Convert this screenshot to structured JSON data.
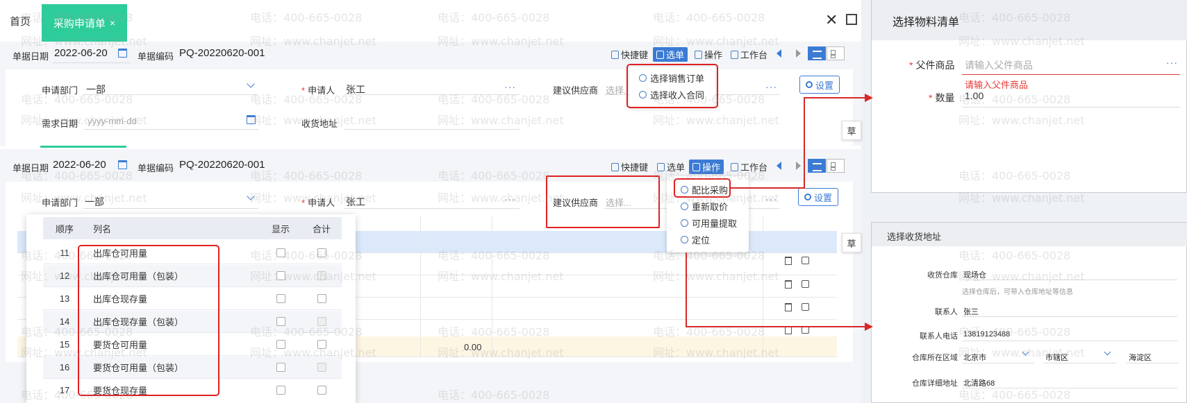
{
  "tabs": {
    "home": "首页",
    "active": "采购申请单",
    "close": "×"
  },
  "window": {
    "close": "✕"
  },
  "form": {
    "date_label": "单据日期",
    "date_value": "2022-06-20",
    "code_label": "单据编码",
    "code_value": "PQ-20220620-001",
    "dept_label": "申请部门",
    "dept_value": "一部",
    "applicant_label": "申请人",
    "applicant_value": "张工",
    "supplier_label": "建议供应商",
    "supplier_placeholder_short": "选择.",
    "supplier_placeholder": "选择...",
    "need_date_label": "需求日期",
    "need_date_placeholder": "yyyy-mm-dd",
    "address_label": "收货地址",
    "settings": "设置",
    "more": "···",
    "required": "*"
  },
  "toolbar": {
    "shortcut": "快捷键",
    "select_doc": "选单",
    "operation": "操作",
    "workbench": "工作台"
  },
  "select_menu": [
    "选择销售订单",
    "选择收入合同"
  ],
  "operation_menu": [
    "配比采购",
    "重新取价",
    "可用量提取",
    "定位"
  ],
  "drawer": {
    "draft": "草"
  },
  "grid": {
    "sum_value": "0.00"
  },
  "column_panel": {
    "headers": {
      "no": "顺序",
      "name": "列名",
      "show": "显示",
      "sum": "合计"
    },
    "rows": [
      {
        "no": "11",
        "name": "出库仓可用量",
        "sum_disabled": false
      },
      {
        "no": "12",
        "name": "出库仓可用量（包装）",
        "sum_disabled": true
      },
      {
        "no": "13",
        "name": "出库仓现存量",
        "sum_disabled": false
      },
      {
        "no": "14",
        "name": "出库仓现存量（包装）",
        "sum_disabled": true
      },
      {
        "no": "15",
        "name": "要货仓可用量",
        "sum_disabled": false
      },
      {
        "no": "16",
        "name": "要货仓可用量（包装）",
        "sum_disabled": true
      },
      {
        "no": "17",
        "name": "要货仓现存量",
        "sum_disabled": false
      }
    ]
  },
  "material_panel": {
    "title": "选择物料清单",
    "parent_label": "父件商品",
    "parent_placeholder": "请输入父件商品",
    "parent_error": "请输入父件商品",
    "qty_label": "数量",
    "qty_value": "1.00"
  },
  "address_panel": {
    "title": "选择收货地址",
    "warehouse_label": "收货仓库",
    "warehouse_value": "现场仓",
    "warehouse_hint": "选择仓库后，可带入仓库地址等信息",
    "contact_label": "联系人",
    "contact_value": "张三",
    "phone_label": "联系人电话",
    "phone_value": "13819123488",
    "region_label": "仓库所在区域",
    "city": "北京市",
    "district": "市辖区",
    "area": "海淀区",
    "detail_label": "仓库详细地址",
    "detail_value": "北清路68"
  },
  "watermark": {
    "phone": "电话：400-665-0028",
    "site": "网址：www.chanjet.net"
  },
  "colors": {
    "accent": "#3b7bd4",
    "tab": "#2ecc9a",
    "error": "#e53935",
    "annotation": "#d62828"
  }
}
